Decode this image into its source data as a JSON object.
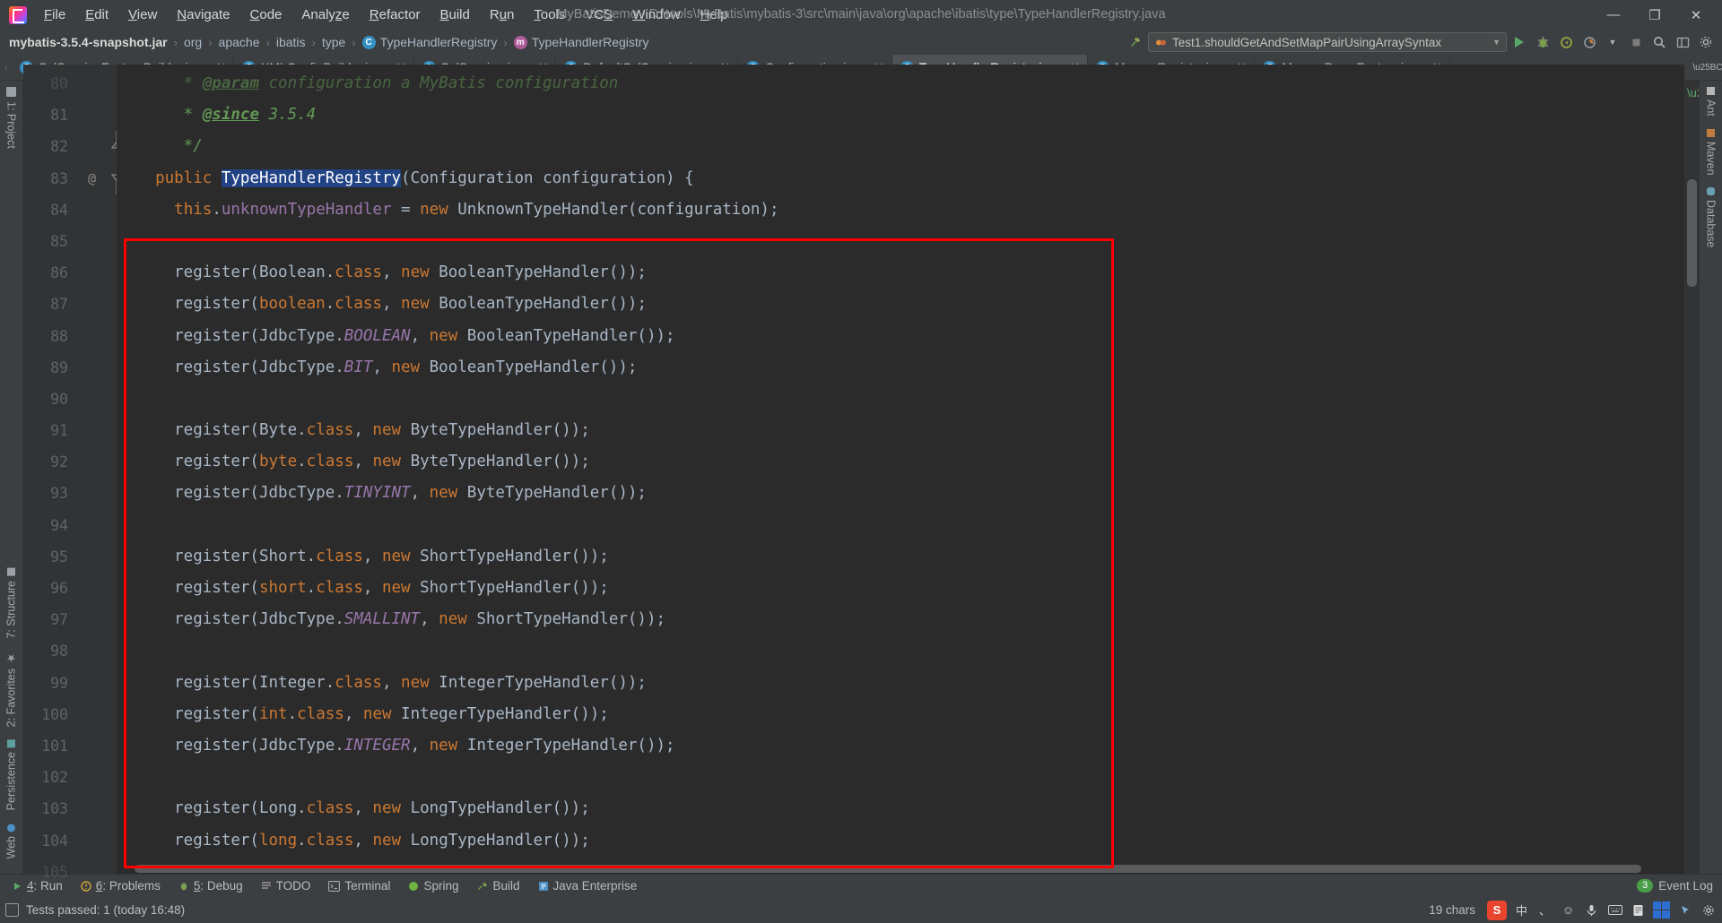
{
  "window": {
    "title": "MyBatisDemo - D:\\tools\\MyBatis\\mybatis-3\\src\\main\\java\\org\\apache\\ibatis\\type\\TypeHandlerRegistry.java",
    "minimize": "—",
    "maximize": "❐",
    "close": "✕"
  },
  "menu": {
    "items": [
      {
        "pre": "",
        "key": "F",
        "post": "ile"
      },
      {
        "pre": "",
        "key": "E",
        "post": "dit"
      },
      {
        "pre": "",
        "key": "V",
        "post": "iew"
      },
      {
        "pre": "",
        "key": "N",
        "post": "avigate"
      },
      {
        "pre": "",
        "key": "C",
        "post": "ode"
      },
      {
        "pre": "Analy",
        "key": "z",
        "post": "e"
      },
      {
        "pre": "",
        "key": "R",
        "post": "efactor"
      },
      {
        "pre": "",
        "key": "B",
        "post": "uild"
      },
      {
        "pre": "R",
        "key": "u",
        "post": "n"
      },
      {
        "pre": "",
        "key": "T",
        "post": "ools"
      },
      {
        "pre": "VC",
        "key": "S",
        "post": ""
      },
      {
        "pre": "",
        "key": "W",
        "post": "indow"
      },
      {
        "pre": "",
        "key": "H",
        "post": "elp"
      }
    ]
  },
  "breadcrumb": {
    "items": [
      {
        "label": "mybatis-3.5.4-snapshot.jar",
        "icon": "",
        "bold": true
      },
      {
        "label": "org",
        "icon": ""
      },
      {
        "label": "apache",
        "icon": ""
      },
      {
        "label": "ibatis",
        "icon": ""
      },
      {
        "label": "type",
        "icon": ""
      },
      {
        "label": "TypeHandlerRegistry",
        "icon": "class-icon",
        "badge": "C"
      },
      {
        "label": "TypeHandlerRegistry",
        "icon": "method-icon",
        "badge": "m"
      }
    ],
    "separator": "›"
  },
  "toolbar": {
    "build_icon": "hammer-icon",
    "run_config": "Test1.shouldGetAndSetMapPairUsingArraySyntax",
    "run_config_caret": "▼",
    "run_label": "run-button",
    "debug_label": "debug-button",
    "coverage_label": "run-with-coverage-button",
    "profiler_label": "profiler-button",
    "stop_label": "stop-button",
    "search_label": "search-everywhere-button",
    "settings_label": "settings-button",
    "layout_label": "layout-button"
  },
  "tabs": [
    {
      "label": "SqlSessionFactoryBuilder.java",
      "icon": "C",
      "type": "c",
      "active": false
    },
    {
      "label": "XMLConfigBuilder.java",
      "icon": "C",
      "type": "c",
      "active": false
    },
    {
      "label": "SqlSession.java",
      "icon": "I",
      "type": "i",
      "active": false
    },
    {
      "label": "DefaultSqlSession.java",
      "icon": "C",
      "type": "c",
      "active": false
    },
    {
      "label": "Configuration.java",
      "icon": "C",
      "type": "c",
      "active": false
    },
    {
      "label": "TypeHandlerRegistry.java",
      "icon": "C",
      "type": "c",
      "active": true
    },
    {
      "label": "MapperRegistry.java",
      "icon": "C",
      "type": "c",
      "active": false
    },
    {
      "label": "MapperProxyFactory.java",
      "icon": "C",
      "type": "c",
      "active": false
    }
  ],
  "tab_close_glyph": "✕",
  "sidebar_left": {
    "items": [
      {
        "label": "1: Project",
        "icon": "folder-icon"
      },
      {
        "label": "7: Structure",
        "icon": "structure-icon"
      },
      {
        "label": "2: Favorites",
        "icon": "star-icon"
      },
      {
        "label": "Persistence",
        "icon": "persistence-icon"
      },
      {
        "label": "Web",
        "icon": "web-icon"
      }
    ]
  },
  "sidebar_right": {
    "items": [
      {
        "label": "Ant",
        "icon": "ant-icon"
      },
      {
        "label": "m",
        "icon": "maven-icon"
      },
      {
        "label": "Maven",
        "icon": "maven-icon"
      },
      {
        "label": "Database",
        "icon": "database-icon"
      }
    ]
  },
  "editor": {
    "file": "TypeHandlerRegistry.java",
    "first_visible_line": 80,
    "lines": [
      {
        "num": "80",
        "at": false,
        "partial": true,
        "tokens": [
          {
            "t": "     * ",
            "c": "cmt"
          },
          {
            "t": "@param",
            "c": "doc-tag"
          },
          {
            "t": " configuration a MyBatis configuration",
            "c": "cmt"
          }
        ]
      },
      {
        "num": "81",
        "at": false,
        "tokens": [
          {
            "t": "     * ",
            "c": "cmt"
          },
          {
            "t": "@since",
            "c": "doc-tag"
          },
          {
            "t": " 3.5.4",
            "c": "cmt"
          }
        ]
      },
      {
        "num": "82",
        "at": false,
        "fold": "end",
        "tokens": [
          {
            "t": "     */",
            "c": "cmt"
          }
        ]
      },
      {
        "num": "83",
        "at": true,
        "fold": "start",
        "tokens": [
          {
            "t": "  ",
            "c": ""
          },
          {
            "t": "public",
            "c": "kw"
          },
          {
            "t": " ",
            "c": ""
          },
          {
            "t": "TypeHandlerRegistry",
            "c": "sel"
          },
          {
            "t": "(Configuration configuration) {",
            "c": "cls"
          }
        ]
      },
      {
        "num": "84",
        "at": false,
        "tokens": [
          {
            "t": "    ",
            "c": ""
          },
          {
            "t": "this",
            "c": "kw"
          },
          {
            "t": ".",
            "c": "cls"
          },
          {
            "t": "unknownTypeHandler",
            "c": "fld"
          },
          {
            "t": " = ",
            "c": "cls"
          },
          {
            "t": "new",
            "c": "kw"
          },
          {
            "t": " UnknownTypeHandler(configuration);",
            "c": "cls"
          }
        ]
      },
      {
        "num": "85",
        "at": false,
        "tokens": []
      },
      {
        "num": "86",
        "at": false,
        "tokens": [
          {
            "t": "    register(Boolean.",
            "c": "cls"
          },
          {
            "t": "class",
            "c": "kw"
          },
          {
            "t": ", ",
            "c": "cls"
          },
          {
            "t": "new",
            "c": "kw"
          },
          {
            "t": " BooleanTypeHandler());",
            "c": "cls"
          }
        ]
      },
      {
        "num": "87",
        "at": false,
        "tokens": [
          {
            "t": "    register(",
            "c": "cls"
          },
          {
            "t": "boolean",
            "c": "kw"
          },
          {
            "t": ".",
            "c": "cls"
          },
          {
            "t": "class",
            "c": "kw"
          },
          {
            "t": ", ",
            "c": "cls"
          },
          {
            "t": "new",
            "c": "kw"
          },
          {
            "t": " BooleanTypeHandler());",
            "c": "cls"
          }
        ]
      },
      {
        "num": "88",
        "at": false,
        "tokens": [
          {
            "t": "    register(JdbcType.",
            "c": "cls"
          },
          {
            "t": "BOOLEAN",
            "c": "sfld"
          },
          {
            "t": ", ",
            "c": "cls"
          },
          {
            "t": "new",
            "c": "kw"
          },
          {
            "t": " BooleanTypeHandler());",
            "c": "cls"
          }
        ]
      },
      {
        "num": "89",
        "at": false,
        "tokens": [
          {
            "t": "    register(JdbcType.",
            "c": "cls"
          },
          {
            "t": "BIT",
            "c": "sfld"
          },
          {
            "t": ", ",
            "c": "cls"
          },
          {
            "t": "new",
            "c": "kw"
          },
          {
            "t": " BooleanTypeHandler());",
            "c": "cls"
          }
        ]
      },
      {
        "num": "90",
        "at": false,
        "tokens": []
      },
      {
        "num": "91",
        "at": false,
        "tokens": [
          {
            "t": "    register(Byte.",
            "c": "cls"
          },
          {
            "t": "class",
            "c": "kw"
          },
          {
            "t": ", ",
            "c": "cls"
          },
          {
            "t": "new",
            "c": "kw"
          },
          {
            "t": " ByteTypeHandler());",
            "c": "cls"
          }
        ]
      },
      {
        "num": "92",
        "at": false,
        "tokens": [
          {
            "t": "    register(",
            "c": "cls"
          },
          {
            "t": "byte",
            "c": "kw"
          },
          {
            "t": ".",
            "c": "cls"
          },
          {
            "t": "class",
            "c": "kw"
          },
          {
            "t": ", ",
            "c": "cls"
          },
          {
            "t": "new",
            "c": "kw"
          },
          {
            "t": " ByteTypeHandler());",
            "c": "cls"
          }
        ]
      },
      {
        "num": "93",
        "at": false,
        "tokens": [
          {
            "t": "    register(JdbcType.",
            "c": "cls"
          },
          {
            "t": "TINYINT",
            "c": "sfld"
          },
          {
            "t": ", ",
            "c": "cls"
          },
          {
            "t": "new",
            "c": "kw"
          },
          {
            "t": " ByteTypeHandler());",
            "c": "cls"
          }
        ]
      },
      {
        "num": "94",
        "at": false,
        "tokens": []
      },
      {
        "num": "95",
        "at": false,
        "tokens": [
          {
            "t": "    register(Short.",
            "c": "cls"
          },
          {
            "t": "class",
            "c": "kw"
          },
          {
            "t": ", ",
            "c": "cls"
          },
          {
            "t": "new",
            "c": "kw"
          },
          {
            "t": " ShortTypeHandler());",
            "c": "cls"
          }
        ]
      },
      {
        "num": "96",
        "at": false,
        "tokens": [
          {
            "t": "    register(",
            "c": "cls"
          },
          {
            "t": "short",
            "c": "kw"
          },
          {
            "t": ".",
            "c": "cls"
          },
          {
            "t": "class",
            "c": "kw"
          },
          {
            "t": ", ",
            "c": "cls"
          },
          {
            "t": "new",
            "c": "kw"
          },
          {
            "t": " ShortTypeHandler());",
            "c": "cls"
          }
        ]
      },
      {
        "num": "97",
        "at": false,
        "tokens": [
          {
            "t": "    register(JdbcType.",
            "c": "cls"
          },
          {
            "t": "SMALLINT",
            "c": "sfld"
          },
          {
            "t": ", ",
            "c": "cls"
          },
          {
            "t": "new",
            "c": "kw"
          },
          {
            "t": " ShortTypeHandler());",
            "c": "cls"
          }
        ]
      },
      {
        "num": "98",
        "at": false,
        "tokens": []
      },
      {
        "num": "99",
        "at": false,
        "tokens": [
          {
            "t": "    register(Integer.",
            "c": "cls"
          },
          {
            "t": "class",
            "c": "kw"
          },
          {
            "t": ", ",
            "c": "cls"
          },
          {
            "t": "new",
            "c": "kw"
          },
          {
            "t": " IntegerTypeHandler());",
            "c": "cls"
          }
        ]
      },
      {
        "num": "100",
        "at": false,
        "tokens": [
          {
            "t": "    register(",
            "c": "cls"
          },
          {
            "t": "int",
            "c": "kw"
          },
          {
            "t": ".",
            "c": "cls"
          },
          {
            "t": "class",
            "c": "kw"
          },
          {
            "t": ", ",
            "c": "cls"
          },
          {
            "t": "new",
            "c": "kw"
          },
          {
            "t": " IntegerTypeHandler());",
            "c": "cls"
          }
        ]
      },
      {
        "num": "101",
        "at": false,
        "tokens": [
          {
            "t": "    register(JdbcType.",
            "c": "cls"
          },
          {
            "t": "INTEGER",
            "c": "sfld"
          },
          {
            "t": ", ",
            "c": "cls"
          },
          {
            "t": "new",
            "c": "kw"
          },
          {
            "t": " IntegerTypeHandler());",
            "c": "cls"
          }
        ]
      },
      {
        "num": "102",
        "at": false,
        "tokens": []
      },
      {
        "num": "103",
        "at": false,
        "tokens": [
          {
            "t": "    register(Long.",
            "c": "cls"
          },
          {
            "t": "class",
            "c": "kw"
          },
          {
            "t": ", ",
            "c": "cls"
          },
          {
            "t": "new",
            "c": "kw"
          },
          {
            "t": " LongTypeHandler());",
            "c": "cls"
          }
        ]
      },
      {
        "num": "104",
        "at": false,
        "tokens": [
          {
            "t": "    register(",
            "c": "cls"
          },
          {
            "t": "long",
            "c": "kw"
          },
          {
            "t": ".",
            "c": "cls"
          },
          {
            "t": "class",
            "c": "kw"
          },
          {
            "t": ", ",
            "c": "cls"
          },
          {
            "t": "new",
            "c": "kw"
          },
          {
            "t": " LongTypeHandler());",
            "c": "cls"
          }
        ]
      },
      {
        "num": "105",
        "at": false,
        "partial": true,
        "tokens": []
      }
    ],
    "annotation": {
      "color": "#ff0000",
      "shape": "rectangle",
      "label": "constructor-highlight-box"
    }
  },
  "bottom_toolbar": {
    "items": [
      {
        "pre": "",
        "key": "4",
        "post": ": Run",
        "icon": "run-icon"
      },
      {
        "pre": "",
        "key": "6",
        "post": ": Problems",
        "icon": "problems-icon"
      },
      {
        "pre": "",
        "key": "5",
        "post": ": Debug",
        "icon": "debug-icon"
      },
      {
        "pre": "TODO",
        "key": "",
        "post": "",
        "icon": "todo-icon"
      },
      {
        "pre": "Terminal",
        "key": "",
        "post": "",
        "icon": "terminal-icon"
      },
      {
        "pre": "Spring",
        "key": "",
        "post": "",
        "icon": "spring-icon"
      },
      {
        "pre": "Build",
        "key": "",
        "post": "",
        "icon": "build-icon"
      },
      {
        "pre": "Java Enterprise",
        "key": "",
        "post": "",
        "icon": "java-enterprise-icon"
      }
    ],
    "event_log": "Event Log",
    "event_badge": "3"
  },
  "statusbar": {
    "message": "Tests passed: 1 (today 16:48)",
    "chars": "19 chars",
    "tray": {
      "ime_label": "中",
      "emoji": "☺",
      "mic": "mic-icon",
      "keyboard": "keyboard-icon",
      "notepad": "notepad-icon",
      "grid": "grid-icon",
      "arrow": "arrow-icon",
      "gear": "gear-icon"
    }
  },
  "colors": {
    "bg_chrome": "#3c3f41",
    "bg_editor": "#2b2b2b",
    "bg_gutter": "#313335",
    "accent_keyword": "#cc7832",
    "accent_field": "#9876aa",
    "accent_comment": "#629755",
    "text_default": "#a9b7c6",
    "selection": "#214283",
    "annotation": "#ff0000",
    "tab_active": "#4e5254"
  }
}
